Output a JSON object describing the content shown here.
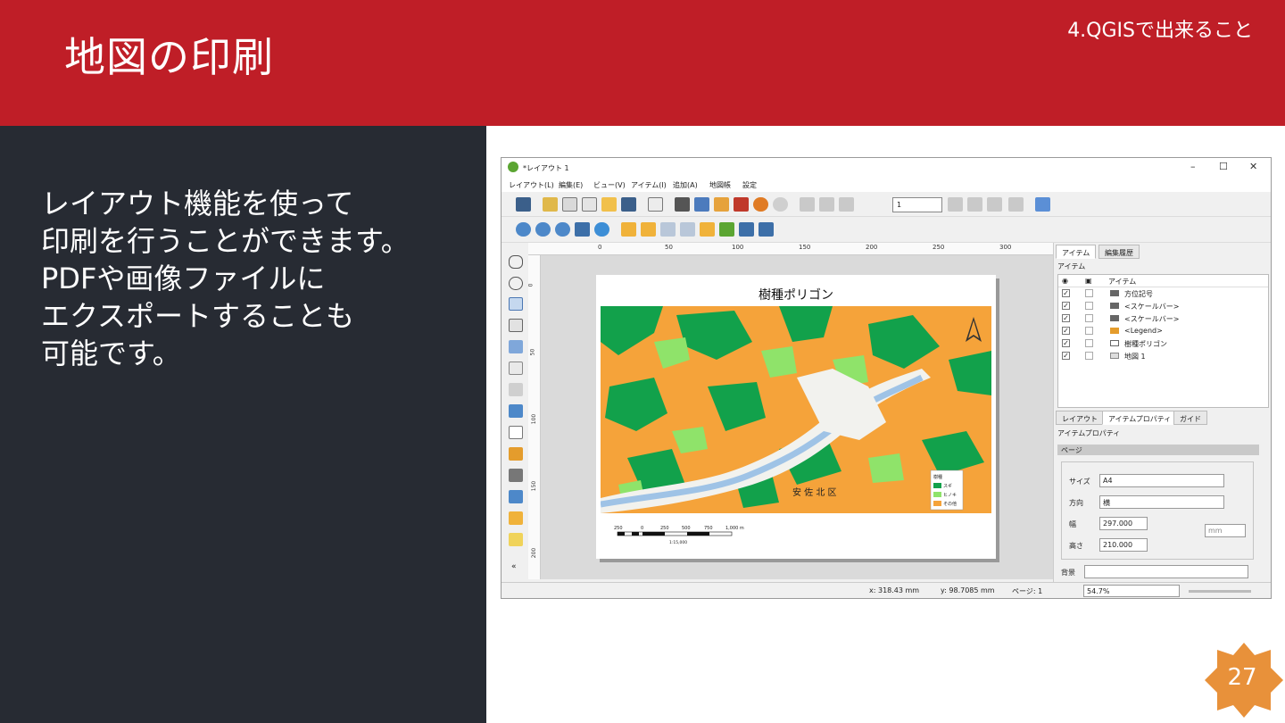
{
  "slide": {
    "title": "地図の印刷",
    "section": "4.QGISで出来ること",
    "body_lines": [
      "レイアウト機能を使って",
      "印刷を行うことができます。",
      "PDFや画像ファイルに",
      "エクスポートすることも",
      "可能です。"
    ],
    "page_number": "27"
  },
  "qgis": {
    "window_title": "*レイアウト 1",
    "window_buttons": [
      "–",
      "☐",
      "✕"
    ],
    "menu": [
      "レイアウト(L)",
      "編集(E)",
      "ビュー(V)",
      "アイテム(I)",
      "追加(A)",
      "地図帳",
      "設定"
    ],
    "page_field": "1",
    "ruler_top": [
      "0",
      "50",
      "100",
      "150",
      "200",
      "250",
      "300"
    ],
    "ruler_left": [
      "0",
      "50",
      "100",
      "150",
      "200"
    ],
    "map_title": "樹種ポリゴン",
    "map_place_label": "安 佐 北 区",
    "legend": {
      "title": "樹種",
      "items": [
        {
          "label": "スギ",
          "color": "#12a14b"
        },
        {
          "label": "ヒノキ",
          "color": "#8fe36a"
        },
        {
          "label": "その他",
          "color": "#f5a33a"
        }
      ]
    },
    "scale_labels": [
      "250",
      "0",
      "250",
      "500",
      "750",
      "1,000 m"
    ],
    "scale_ratio": "1:15,000",
    "right_tabs_top": [
      "アイテム",
      "編集履歴"
    ],
    "items_panel_title": "アイテム",
    "items_header": "アイテム",
    "items": [
      {
        "label": "方位記号",
        "checked": "✓"
      },
      {
        "label": "<スケールバー>",
        "checked": "✓"
      },
      {
        "label": "<スケールバー>",
        "checked": "✓"
      },
      {
        "label": "<Legend>",
        "checked": "✓"
      },
      {
        "label": "樹種ポリゴン",
        "checked": "✓"
      },
      {
        "label": "地図 1",
        "checked": "✓"
      }
    ],
    "right_tabs_bottom": [
      "レイアウト",
      "アイテムプロパティ",
      "ガイド"
    ],
    "props_panel_title": "アイテムプロパティ",
    "page_section": "ページ",
    "props": {
      "size_label": "サイズ",
      "size_value": "A4",
      "orient_label": "方向",
      "orient_value": "横",
      "width_label": "幅",
      "width_value": "297.000",
      "height_label": "高さ",
      "height_value": "210.000",
      "unit": "mm",
      "bg_label": "背景"
    },
    "status": {
      "x": "x: 318.43 mm",
      "y": "y: 98.7085 mm",
      "page": "ページ: 1",
      "zoom": "54.7%"
    }
  },
  "colors": {
    "header_red": "#bf1e27",
    "panel_dark": "#272b33",
    "badge_orange": "#e8913a",
    "map_orange": "#f5a33a",
    "map_green": "#12a14b",
    "map_lightgreen": "#8fe36a",
    "river_blue": "#9fc3e6"
  }
}
